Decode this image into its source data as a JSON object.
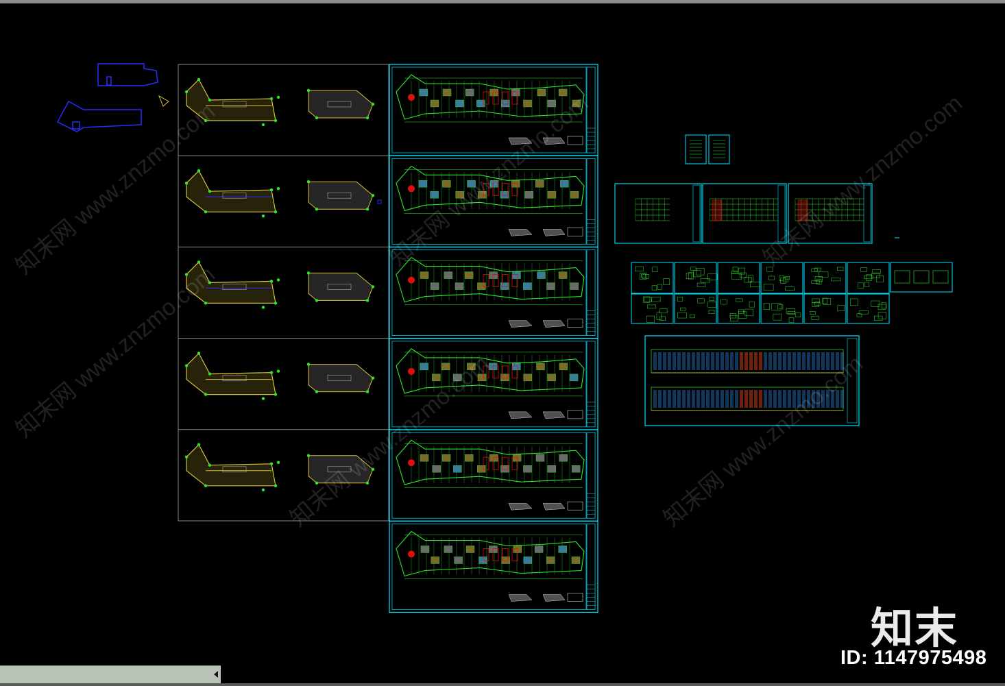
{
  "watermark": {
    "brand": "知末",
    "id_text": "ID: 1147975498",
    "repeat_text": "知末网 www.znzmo.com"
  },
  "status_bar": {
    "scroll_icon": "caret-left-icon"
  },
  "colors": {
    "background": "#000000",
    "frame_cyan": "#00e5ff",
    "frame_gray": "#8a8a8a",
    "plan_green": "#2ee82e",
    "area_yellow": "#d6c23a",
    "outline_blue": "#2a2aff",
    "accent_red": "#e01010"
  },
  "drawings": {
    "area_sheets": 5,
    "floor_plan_sheets": 6,
    "elevation_sheets": 3,
    "detail_sheets": 12,
    "section_sheets": 1
  }
}
